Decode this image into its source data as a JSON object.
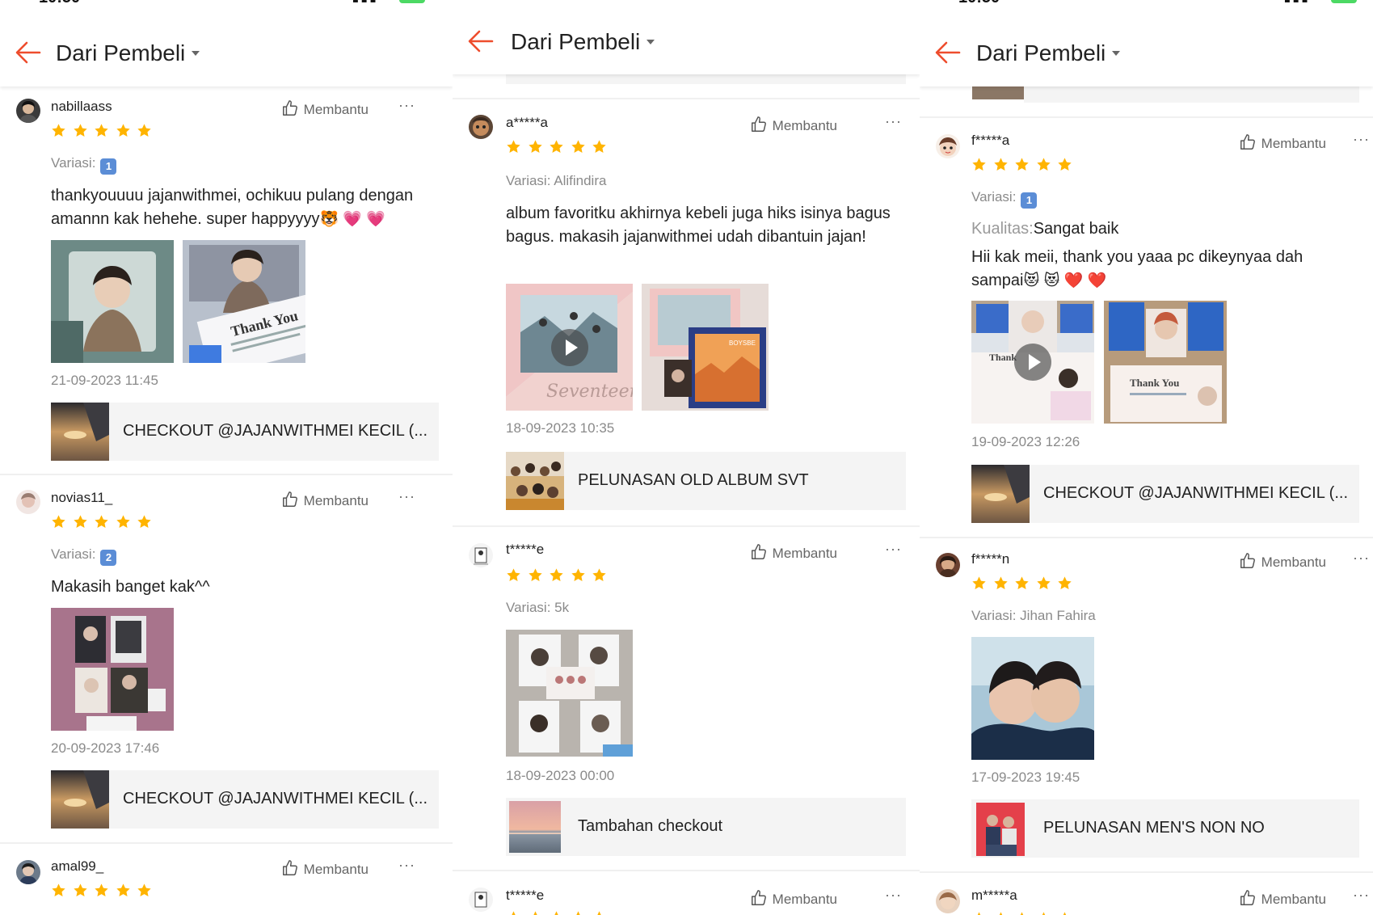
{
  "header_title": "Dari Pembeli",
  "helpful_label": "Membantu",
  "more_label": "···",
  "variation_label": "Variasi:",
  "quality_label": "Kualitas:",
  "colors": {
    "accent": "#ee4d2d",
    "star": "#ffb400",
    "muted": "#8a8a8a",
    "product_bg": "#f4f4f4"
  },
  "panels": [
    {
      "reviews": [
        {
          "username": "nabillaass",
          "rating": 5,
          "variation": "1",
          "comment": "thankyouuuu jajanwithmei, ochikuu pulang dengan amannn kak hehehe. super happyyyy",
          "emojis": "🐯 💗 💗",
          "date": "21-09-2023 11:45",
          "product_name": "CHECKOUT @JAJANWITHMEI KECIL (..."
        },
        {
          "username": "novias11_",
          "rating": 5,
          "variation": "2",
          "comment": "Makasih banget kak^^",
          "date": "20-09-2023 17:46",
          "product_name": "CHECKOUT @JAJANWITHMEI KECIL (..."
        },
        {
          "username": "amal99_",
          "rating": 5
        }
      ]
    },
    {
      "reviews": [
        {
          "username": "a*****a",
          "rating": 5,
          "variation": "Alifindira",
          "comment": "album favoritku akhirnya kebeli juga hiks isinya bagus bagus. makasih jajanwithmei udah dibantuin jajan!",
          "date": "18-09-2023 10:35",
          "product_name": "PELUNASAN OLD ALBUM SVT"
        },
        {
          "username": "t*****e",
          "rating": 5,
          "variation": "5k",
          "date": "18-09-2023 00:00",
          "product_name": "Tambahan checkout"
        },
        {
          "username": "t*****e",
          "rating": 5
        }
      ]
    },
    {
      "reviews": [
        {
          "username": "f*****a",
          "rating": 5,
          "variation": "1",
          "quality": "Sangat baik",
          "comment": "Hii kak meii, thank you yaaa pc dikeynyaa dah sampai",
          "emojis": "😻 😻 ❤️ ❤️",
          "date": "19-09-2023 12:26",
          "product_name": "CHECKOUT @JAJANWITHMEI KECIL (..."
        },
        {
          "username": "f*****n",
          "rating": 5,
          "variation": "Jihan Fahira",
          "date": "17-09-2023 19:45",
          "product_name": "PELUNASAN MEN'S NON NO"
        },
        {
          "username": "m*****a",
          "rating": 5
        }
      ]
    }
  ]
}
